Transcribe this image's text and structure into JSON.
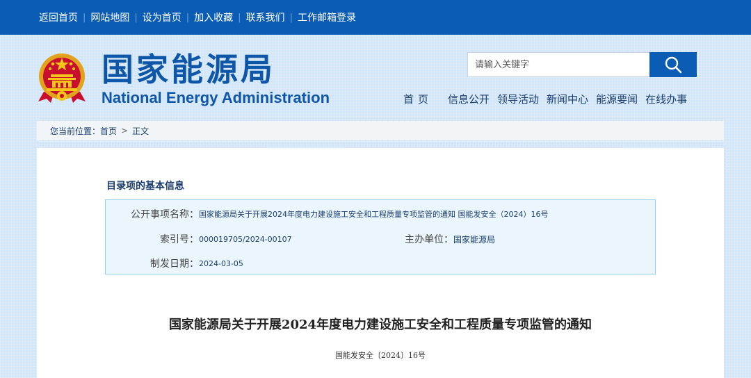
{
  "topbar": {
    "links": [
      "返回首页",
      "网站地图",
      "设为首页",
      "加入收藏",
      "联系我们",
      "工作邮箱登录"
    ]
  },
  "header": {
    "logo_cn": "国家能源局",
    "logo_en": "National Energy Administration",
    "emblem_icon": "national-emblem-icon",
    "search_placeholder": "请输入关键字",
    "search_icon": "search-icon"
  },
  "nav": {
    "home": "首页",
    "items": [
      "信息公开",
      "领导活动",
      "新闻中心",
      "能源要闻",
      "在线办事"
    ]
  },
  "breadcrumb": {
    "prefix": "您当前位置：",
    "home": "首页",
    "separator": ">",
    "current": "正文"
  },
  "info": {
    "section_title": "目录项的基本信息",
    "name_label": "公开事项名称：",
    "name_value": "国家能源局关于开展2024年度电力建设施工安全和工程质量专项监管的通知 国能发安全（2024）16号",
    "index_label": "索引号：",
    "index_value": "000019705/2024-00107",
    "unit_label": "主办单位：",
    "unit_value": "国家能源局",
    "date_label": "制发日期：",
    "date_value": "2024-03-05"
  },
  "article": {
    "title": "国家能源局关于开展2024年度电力建设施工安全和工程质量专项监管的通知",
    "doc_number": "国能发安全〔2024〕16号"
  },
  "colors": {
    "topbar": "#0a5cb4",
    "brand_blue": "#0d56a8",
    "page_bg": "#d3e6f7",
    "info_box_bg": "#eaf6fb",
    "info_box_border": "#8fd2ee"
  }
}
